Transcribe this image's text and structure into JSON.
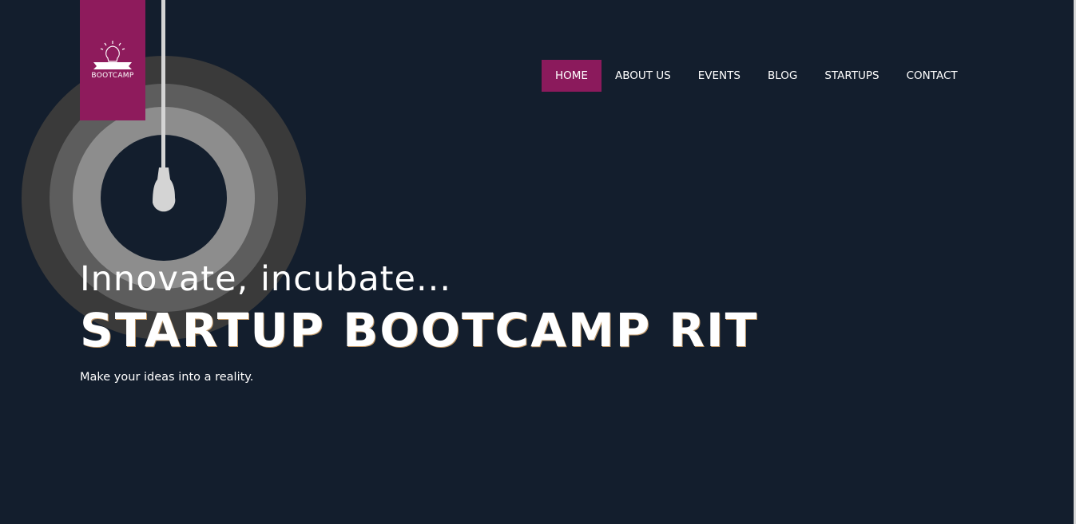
{
  "logo": {
    "text": "BOOTCAMP",
    "icon": "lightbulb-icon",
    "bg_color": "#8e1b5c"
  },
  "nav": {
    "items": [
      {
        "label": "HOME",
        "active": true
      },
      {
        "label": "ABOUT US",
        "active": false
      },
      {
        "label": "EVENTS",
        "active": false
      },
      {
        "label": "BLOG",
        "active": false
      },
      {
        "label": "STARTUPS",
        "active": false
      },
      {
        "label": "CONTACT",
        "active": false
      }
    ],
    "active_color": "#8b1a5c"
  },
  "hero": {
    "subtitle": "Innovate, incubate...",
    "title": "STARTUP BOOTCAMP RIT",
    "tagline": "Make your ideas into a reality."
  },
  "colors": {
    "background": "#131e2d",
    "ring_outer": "#3a3a3a",
    "ring_middle": "#5d5d5d",
    "ring_inner": "#8d8d8d",
    "cord": "#d4d4d4"
  }
}
